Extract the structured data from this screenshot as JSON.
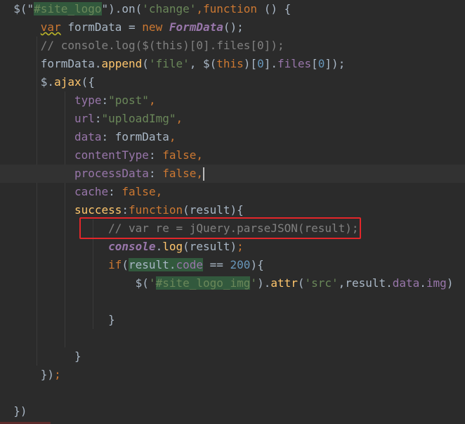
{
  "lines": {
    "l1": {
      "a": "$(\"",
      "b": "#site_logo",
      "c": "\").on(",
      "d": "'change'",
      "e": ",",
      "f": "function",
      "g": " () {"
    },
    "l2": {
      "a": "var",
      "b": " formData = ",
      "c": "new",
      "d": " ",
      "e": "FormData",
      "f": "();"
    },
    "l3": {
      "a": "// console.log($(this)[0].files[0]);"
    },
    "l4": {
      "a": "formData.",
      "b": "append",
      "c": "(",
      "d": "'file'",
      "e": ", $(",
      "f": "this",
      "g": ")[",
      "h": "0",
      "i": "].",
      "j": "files",
      "k": "[",
      "l": "0",
      "m": "]);"
    },
    "l5": {
      "a": "$.",
      "b": "ajax",
      "c": "({"
    },
    "l6": {
      "a": "type",
      "b": ":",
      "c": "\"post\"",
      "d": ","
    },
    "l7": {
      "a": "url",
      "b": ":",
      "c": "\"uploadImg\"",
      "d": ","
    },
    "l8": {
      "a": "data",
      "b": ": formData",
      "c": ","
    },
    "l9": {
      "a": "contentType",
      "b": ": ",
      "c": "false",
      "d": ","
    },
    "l10": {
      "a": "processData",
      "b": ": ",
      "c": "false",
      "d": ","
    },
    "l11": {
      "a": "cache",
      "b": ": ",
      "c": "false",
      "d": ","
    },
    "l12": {
      "a": "success",
      "b": ":",
      "c": "function",
      "d": "(result){"
    },
    "l13": {
      "a": "// var re = jQuery.parseJSON(result);"
    },
    "l14": {
      "a": "console",
      "b": ".",
      "c": "log",
      "d": "(result)",
      "e": ";"
    },
    "l15": {
      "a": "if",
      "b": "(",
      "c": "result.",
      "d": "code",
      "e": " == ",
      "f": "200",
      "g": "){"
    },
    "l16": {
      "a": "$(",
      "b": "'",
      "c": "#site_logo_img",
      "d": "'",
      "e": ").",
      "f": "attr",
      "g": "(",
      "h": "'src'",
      "i": ",result.",
      "j": "data",
      "k": ".",
      "l": "img",
      "m": ")"
    },
    "l18": {
      "a": "}"
    },
    "l20": {
      "a": "}"
    },
    "l21": {
      "a": "})",
      "b": ";"
    },
    "l23": {
      "a": "})"
    }
  },
  "colors": {
    "background": "#2b2b2b",
    "keyword": "#cc7832",
    "string": "#6a8759",
    "comment": "#808080",
    "property": "#9876aa",
    "function": "#ffc66d",
    "number": "#6897bb",
    "highlight_box": "#e3262a"
  }
}
